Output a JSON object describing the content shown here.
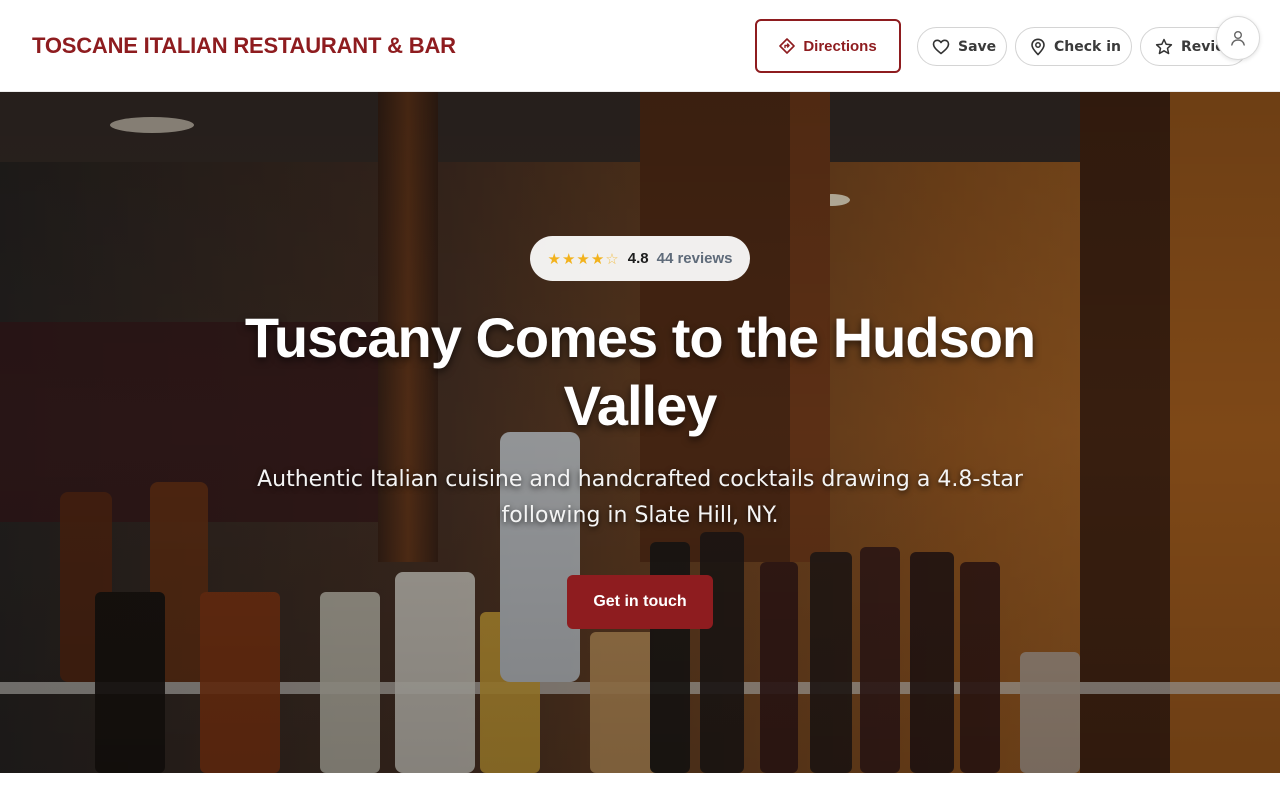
{
  "header": {
    "brand": "TOSCANE ITALIAN RESTAURANT & BAR",
    "directions_label": "Directions",
    "save_label": "Save",
    "checkin_label": "Check in",
    "review_label": "Review"
  },
  "hero": {
    "rating": {
      "stars_filled": 4.5,
      "stars_total": 5,
      "value": "4.8",
      "reviews": "44 reviews"
    },
    "title": "Tuscany Comes to the Hudson Valley",
    "subtitle": "Authentic Italian cuisine and handcrafted cocktails drawing a 4.8-star following in Slate Hill, NY.",
    "cta_label": "Get in touch",
    "background_description_icons": [
      "bar-shelf-photo"
    ]
  },
  "colors": {
    "brand": "#8e1c1f",
    "star": "#f2b21c",
    "muted_text": "#5f6b7a"
  },
  "icons": {
    "directions": "directions-icon",
    "save": "heart-icon",
    "checkin": "map-pin-icon",
    "review": "star-outline-icon",
    "account": "user-icon"
  }
}
